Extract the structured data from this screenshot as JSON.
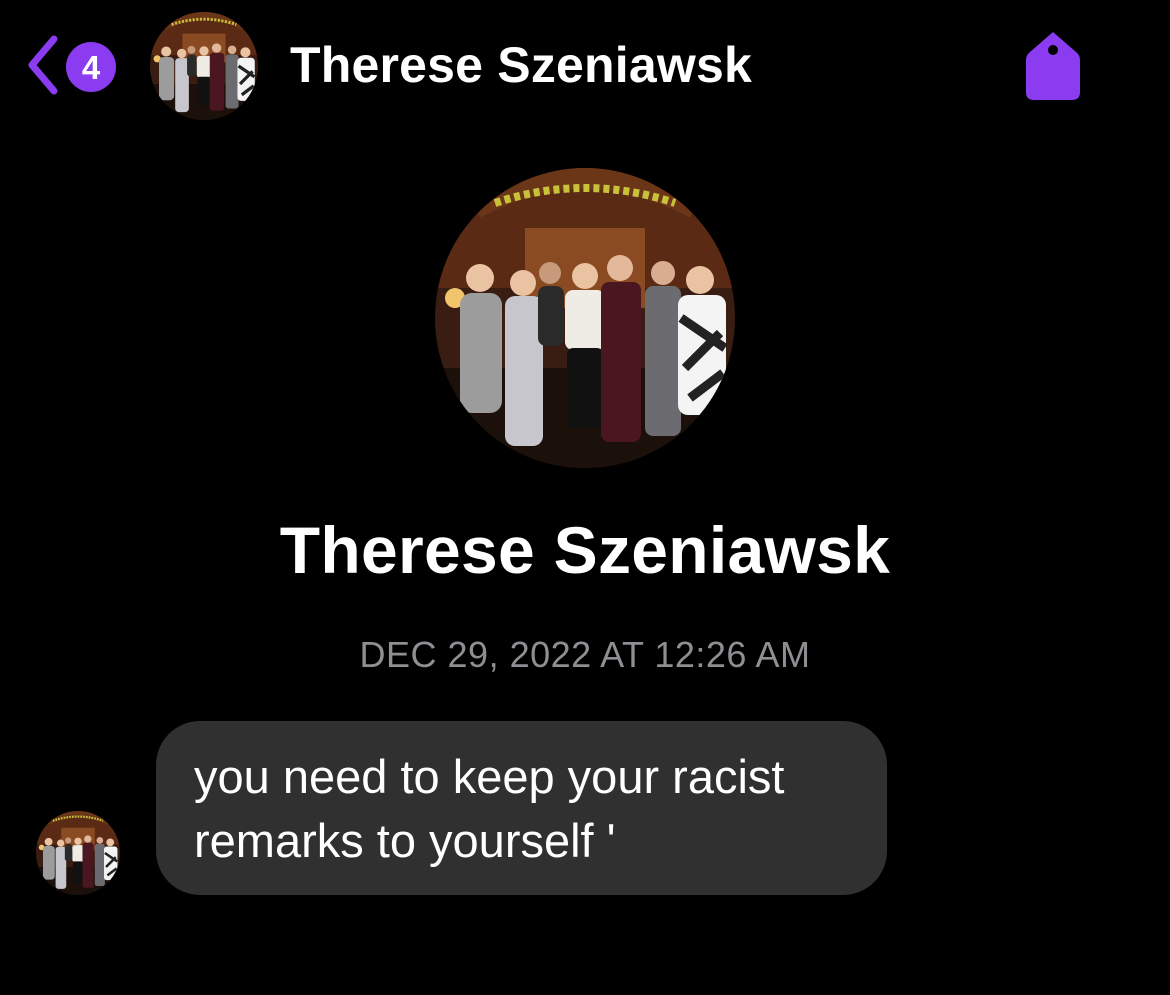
{
  "header": {
    "back_badge_count": "4",
    "contact_name": "Therese Szeniawsk",
    "accent_color": "#8c3cf0",
    "back_icon": "chevron-left-icon",
    "tag_icon": "tag-icon"
  },
  "profile": {
    "name": "Therese Szeniawsk"
  },
  "conversation": {
    "timestamp": "DEC 29, 2022 AT 12:26 AM",
    "messages": [
      {
        "sender": "incoming",
        "text": "you need to keep your racist\nremarks to yourself '"
      }
    ]
  },
  "colors": {
    "background": "#000000",
    "bubble_incoming": "#303030",
    "timestamp": "#8e8e93",
    "accent": "#8c3cf0"
  }
}
